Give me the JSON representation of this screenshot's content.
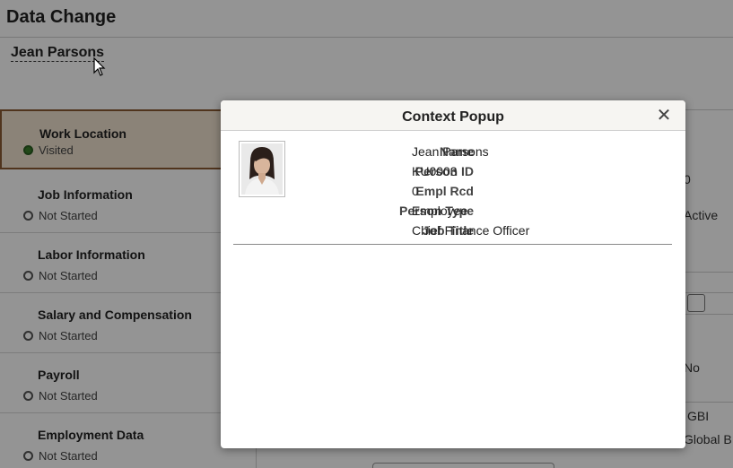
{
  "page": {
    "title": "Data Change",
    "person_name": "Jean Parsons"
  },
  "steps": [
    {
      "label": "Work Location",
      "status": "Visited",
      "state": "visited"
    },
    {
      "label": "Job Information",
      "status": "Not Started",
      "state": "not-started"
    },
    {
      "label": "Labor Information",
      "status": "Not Started",
      "state": "not-started"
    },
    {
      "label": "Salary and Compensation",
      "status": "Not Started",
      "state": "not-started"
    },
    {
      "label": "Payroll",
      "status": "Not Started",
      "state": "not-started"
    },
    {
      "label": "Employment Data",
      "status": "Not Started",
      "state": "not-started"
    }
  ],
  "background": {
    "value_0": "0",
    "value_active": "Active",
    "value_no": "No",
    "value_gbi": "GBI",
    "value_global": "Global B"
  },
  "modal": {
    "title": "Context Popup",
    "close_icon": "close-icon",
    "fields": [
      {
        "label": "Name",
        "value": "Jean Parsons"
      },
      {
        "label": "Person ID",
        "value": "KU0003"
      },
      {
        "label": "Empl Rcd",
        "value": "0"
      },
      {
        "label": "Person Type",
        "value": "Employee"
      },
      {
        "label": "Job Title",
        "value": "Chief Finance Officer"
      }
    ]
  },
  "colors": {
    "active_step_bg": "#efe2cf",
    "active_step_border": "#8a5a33",
    "visited_dot": "#3a7d2a",
    "overlay": "rgba(0,0,0,0.42)"
  }
}
